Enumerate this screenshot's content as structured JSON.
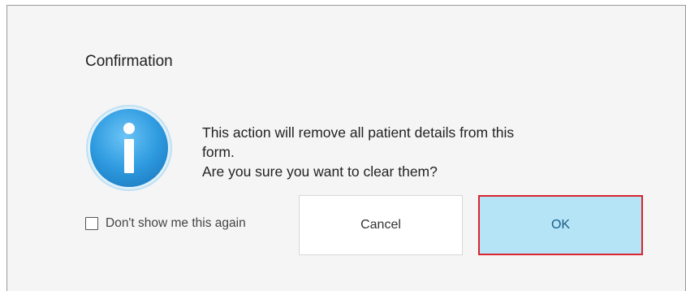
{
  "dialog": {
    "title": "Confirmation",
    "icon": "info-icon",
    "message_lines": [
      "This action will remove all patient details from this",
      "form.",
      "Are you sure you want to clear them?"
    ],
    "dont_show_again_label": "Don't show me this again",
    "dont_show_again_checked": false,
    "cancel_label": "Cancel",
    "ok_label": "OK"
  },
  "colors": {
    "dialog_background": "#f5f5f5",
    "icon_blue": "#2f9be0",
    "ok_background": "#b5e4f6",
    "ok_border": "#d9252f"
  }
}
